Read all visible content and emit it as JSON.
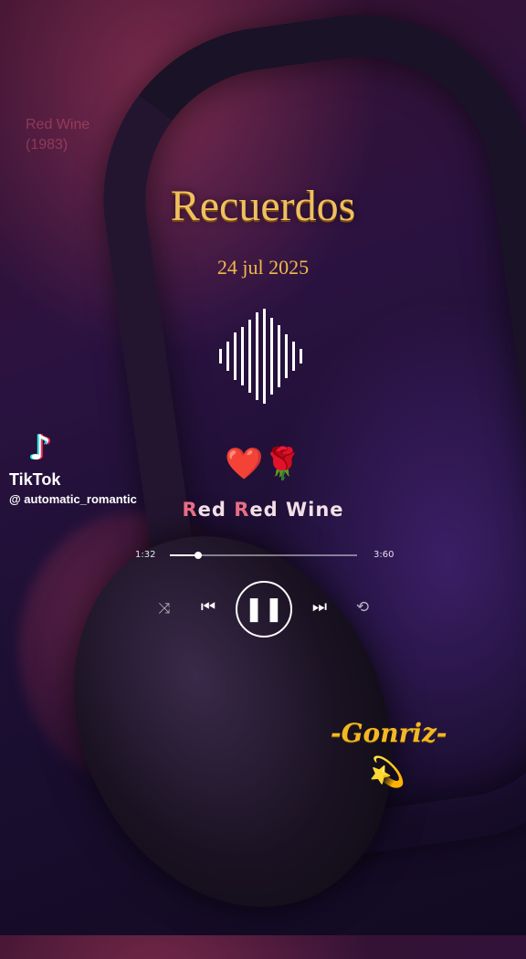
{
  "background_text": {
    "line1": "Red Wine",
    "line2": "(1983)"
  },
  "title": "Recuerdos",
  "date": "24 jul 2025",
  "tiktok": {
    "brand": "TikTok",
    "handle": "@ automatic_romantic"
  },
  "emojis": "❤️🌹",
  "song": {
    "word1_first": "R",
    "word1_rest": "ed ",
    "word2_first": "R",
    "word2_rest": "ed Wine"
  },
  "player": {
    "current_time": "1:32",
    "total_time": "3:60",
    "progress": 0.15,
    "shuffle_icon": "⤨",
    "prev_icon": "⏮",
    "play_pause_icon": "❚❚",
    "next_icon": "⏭",
    "repeat_icon": "⟲"
  },
  "signature": "-Gonriz-",
  "signature_emoji": "💫",
  "colors": {
    "title": "#f0c060",
    "song_accent": "#e96d86",
    "signature": "#f3b823"
  }
}
